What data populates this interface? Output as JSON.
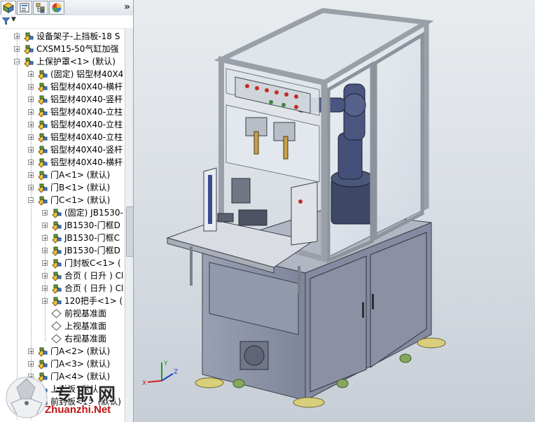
{
  "panel": {
    "tabs": [
      "feature-manager",
      "property-manager",
      "configuration-manager",
      "appearance-manager"
    ],
    "expand_label": "»",
    "filter_label": "▼"
  },
  "tree": {
    "items": [
      {
        "label": "设备架子-上挡板-18 S",
        "toggle": "+",
        "icon": "assembly-part"
      },
      {
        "label": "CXSM15-50气缸加强",
        "toggle": "+",
        "icon": "assembly-part"
      },
      {
        "label": "上保护罩<1> (默认)",
        "toggle": "−",
        "icon": "assembly-part"
      },
      {
        "label": "(固定) 铝型材40X4",
        "toggle": "+",
        "icon": "assembly-part"
      },
      {
        "label": "铝型材40X40-横杆",
        "toggle": "+",
        "icon": "assembly-part"
      },
      {
        "label": "铝型材40X40-竖杆",
        "toggle": "+",
        "icon": "assembly-part"
      },
      {
        "label": "铝型材40X40-立柱",
        "toggle": "+",
        "icon": "assembly-part"
      },
      {
        "label": "铝型材40X40-立柱",
        "toggle": "+",
        "icon": "assembly-part"
      },
      {
        "label": "铝型材40X40-立柱",
        "toggle": "+",
        "icon": "assembly-part"
      },
      {
        "label": "铝型材40X40-竖杆",
        "toggle": "+",
        "icon": "assembly-part"
      },
      {
        "label": "铝型材40X40-横杆",
        "toggle": "+",
        "icon": "assembly-part"
      },
      {
        "label": "门A<1> (默认)",
        "toggle": "+",
        "icon": "assembly-part"
      },
      {
        "label": "门B<1> (默认)",
        "toggle": "+",
        "icon": "assembly-part"
      },
      {
        "label": "门C<1> (默认)",
        "toggle": "−",
        "icon": "assembly-part"
      },
      {
        "label": "(固定) JB1530-",
        "toggle": "+",
        "icon": "assembly-part"
      },
      {
        "label": "JB1530-门框D",
        "toggle": "+",
        "icon": "assembly-part"
      },
      {
        "label": "JB1530-门框C",
        "toggle": "+",
        "icon": "assembly-part"
      },
      {
        "label": "JB1530-门框D",
        "toggle": "+",
        "icon": "assembly-part"
      },
      {
        "label": "门封板C<1> (",
        "toggle": "+",
        "icon": "assembly-part"
      },
      {
        "label": "合页 ( 日升 ) Cl",
        "toggle": "+",
        "icon": "assembly-part"
      },
      {
        "label": "合页 ( 日升 ) Cl",
        "toggle": "+",
        "icon": "assembly-part"
      },
      {
        "label": "120把手<1> (",
        "toggle": "+",
        "icon": "assembly-part"
      },
      {
        "label": "前视基准面",
        "toggle": "",
        "icon": "plane"
      },
      {
        "label": "上视基准面",
        "toggle": "",
        "icon": "plane"
      },
      {
        "label": "右视基准面",
        "toggle": "",
        "icon": "plane"
      },
      {
        "label": "门A<2> (默认)",
        "toggle": "+",
        "icon": "assembly-part"
      },
      {
        "label": "门A<3> (默认)",
        "toggle": "+",
        "icon": "assembly-part"
      },
      {
        "label": "门A<4> (默认)",
        "toggle": "+",
        "icon": "assembly-part"
      },
      {
        "label": "上封板 (默认",
        "toggle": "+",
        "icon": "assembly-part"
      },
      {
        "label": "前封板<1> (默认)",
        "toggle": "+",
        "icon": "assembly-part"
      }
    ]
  },
  "splitter_label": "◂",
  "triad": {
    "x": "X",
    "y": "Y",
    "z": "Z"
  },
  "watermark": {
    "brand": "专职网",
    "url": "Zhuanzhi.Net"
  },
  "colors": {
    "frame": "#a9afb8",
    "cabinet": "#8e94a8",
    "glass": "#dfe6ec",
    "robot": "#3d4866",
    "feet": "#d8cf7c",
    "wheels": "#86a85e",
    "button_red": "#c62a2a",
    "button_green": "#3c8a3c"
  }
}
